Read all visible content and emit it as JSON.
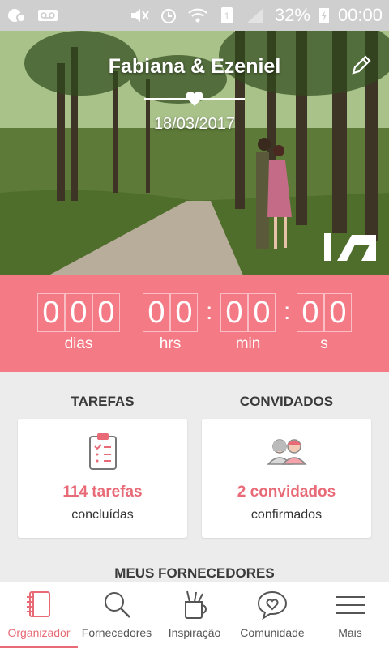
{
  "status_bar": {
    "battery": "32%",
    "time": "00:00"
  },
  "hero": {
    "couple_names": "Fabiana & Ezeniel",
    "wedding_date": "18/03/2017"
  },
  "countdown": {
    "days": [
      "0",
      "0",
      "0"
    ],
    "hours": [
      "0",
      "0"
    ],
    "minutes": [
      "0",
      "0"
    ],
    "seconds": [
      "0",
      "0"
    ],
    "labels": {
      "days": "dias",
      "hours": "hrs",
      "minutes": "min",
      "seconds": "s"
    }
  },
  "tasks": {
    "title": "TAREFAS",
    "count": "114 tarefas",
    "sub": "concluídas"
  },
  "guests": {
    "title": "CONVIDADOS",
    "count": "2 convidados",
    "sub": "confirmados"
  },
  "suppliers": {
    "title": "MEUS FORNECEDORES"
  },
  "nav": {
    "items": [
      {
        "label": "Organizador",
        "icon": "notebook-icon",
        "active": true
      },
      {
        "label": "Fornecedores",
        "icon": "search-icon"
      },
      {
        "label": "Inspiração",
        "icon": "brush-cup-icon"
      },
      {
        "label": "Comunidade",
        "icon": "heart-chat-icon"
      },
      {
        "label": "Mais",
        "icon": "menu-icon"
      }
    ]
  },
  "colors": {
    "accent": "#f47b86",
    "accent_text": "#e86a77"
  }
}
